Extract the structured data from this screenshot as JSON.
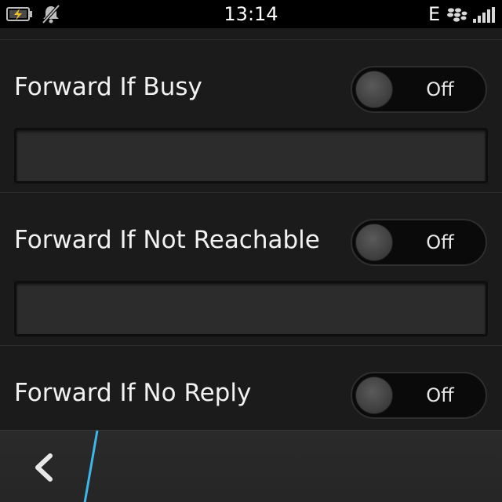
{
  "status_bar": {
    "time": "13:14",
    "network_type": "E",
    "icons": [
      "battery-charging-icon",
      "notifications-muted-icon",
      "blackberry-icon",
      "signal-icon"
    ]
  },
  "settings": [
    {
      "label": "Forward If Busy",
      "toggle_state": "Off",
      "number_value": ""
    },
    {
      "label": "Forward If Not Reachable",
      "toggle_state": "Off",
      "number_value": ""
    },
    {
      "label": "Forward If No Reply",
      "toggle_state": "Off",
      "number_value": ""
    }
  ],
  "action_bar": {
    "back_icon": "chevron-left-icon"
  },
  "colors": {
    "background": "#1b1b1b",
    "accent": "#3db6e8",
    "battery_charge": "#f0c020"
  }
}
